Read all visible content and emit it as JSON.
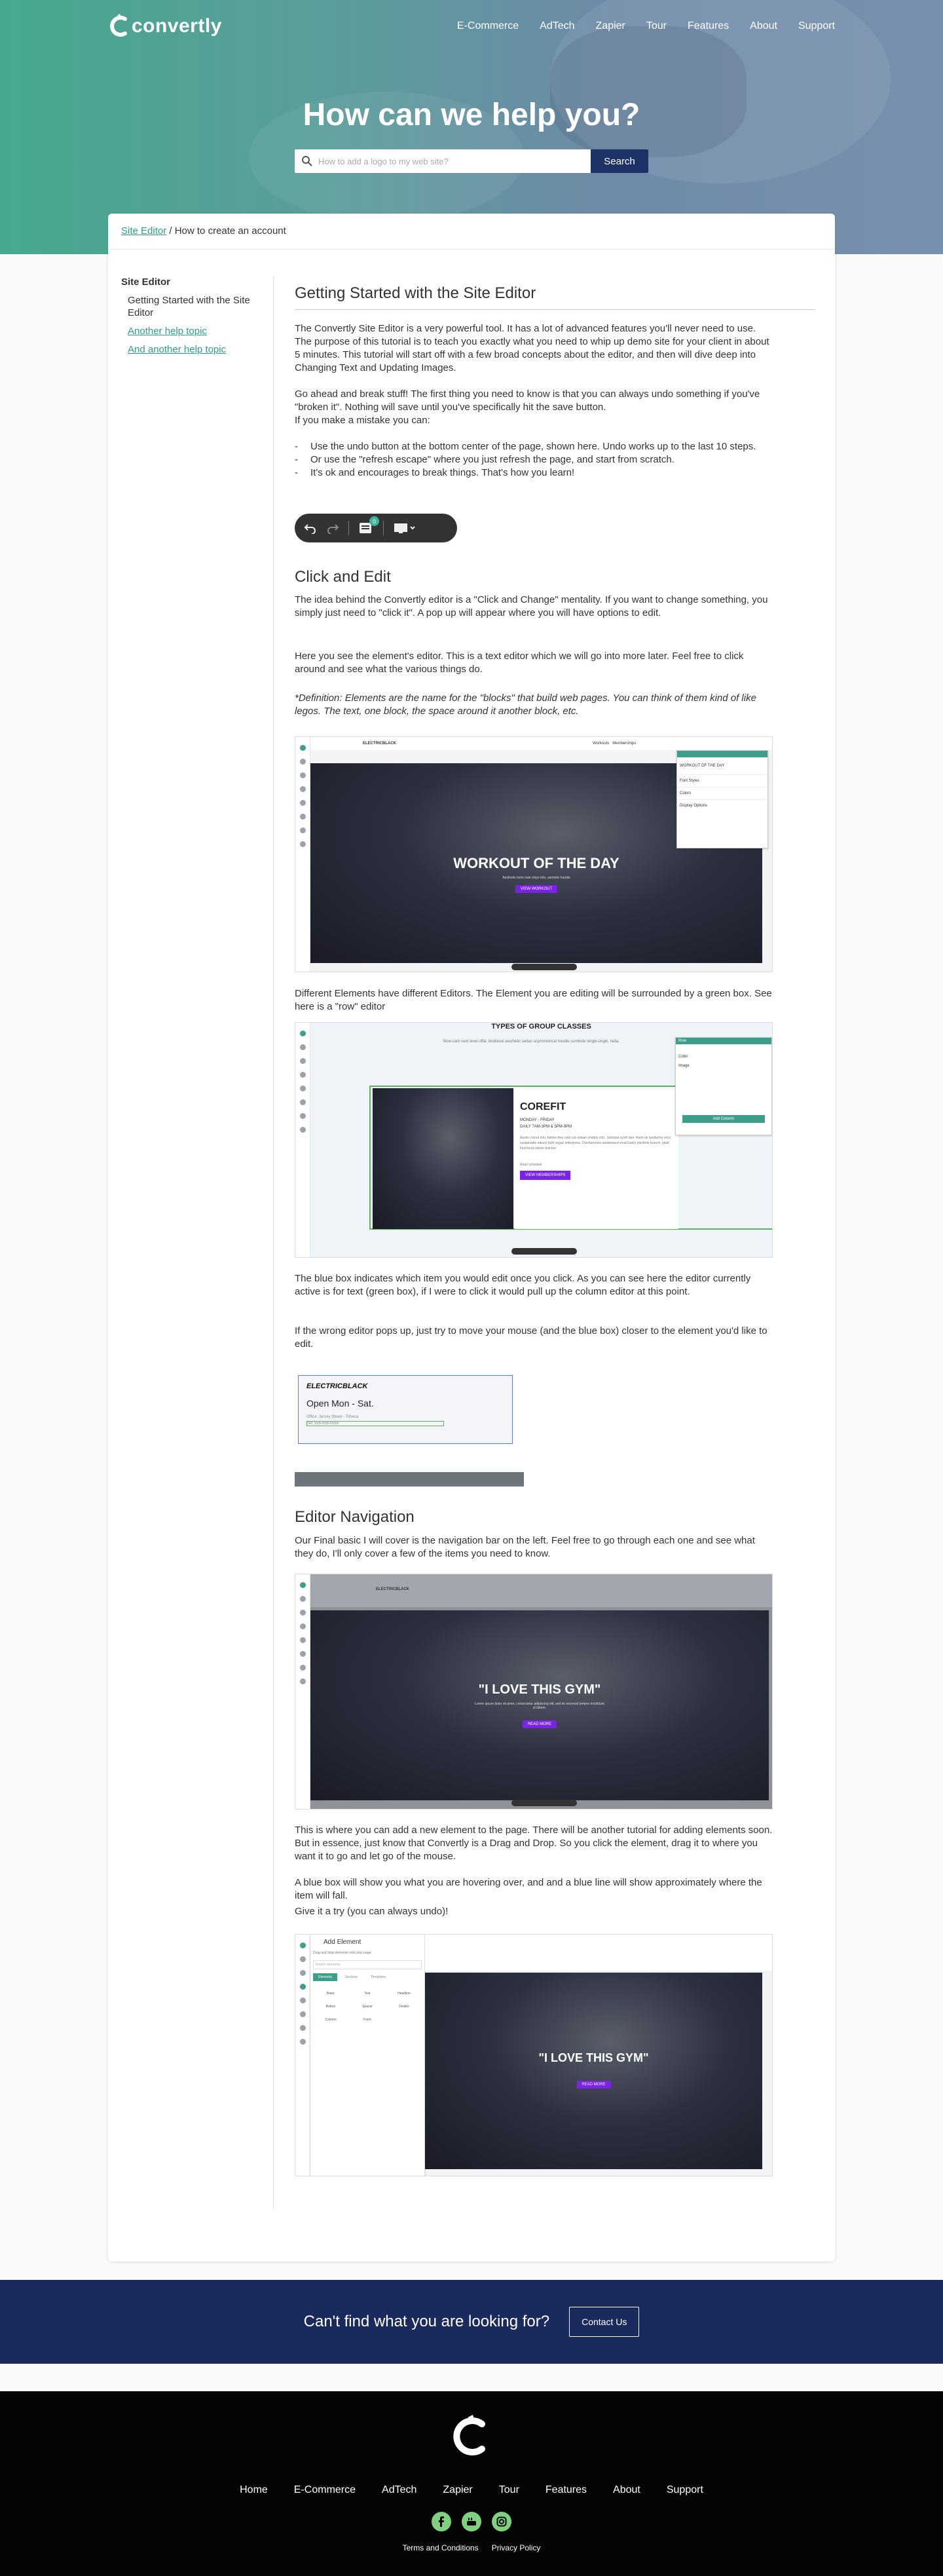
{
  "brand": {
    "name": "Convertly"
  },
  "nav": {
    "items": [
      "E-Commerce",
      "AdTech",
      "Zapier",
      "Tour",
      "Features",
      "About",
      "Support"
    ]
  },
  "hero": {
    "title": "How can we help you?",
    "search_placeholder": "How to add a logo to my web site?",
    "search_button": "Search"
  },
  "breadcrumb": {
    "link": "Site Editor",
    "sep": " / ",
    "current": "How to create an account"
  },
  "sidebar": {
    "heading": "Site Editor",
    "items": [
      {
        "label": "Getting Started with the Site Editor",
        "link": false
      },
      {
        "label": "Another help topic",
        "link": true
      },
      {
        "label": "And another help topic",
        "link": true
      }
    ]
  },
  "article": {
    "h1": "Getting Started with the Site Editor",
    "p1": "The Convertly Site Editor is a very powerful tool. It has a lot of advanced features you'll never need to use.  The purpose of this tutorial is to teach you exactly what you need to whip up demo site for your client in about 5 minutes.  This tutorial will start off with a few broad concepts about the editor, and then will dive deep into Changing Text and Updating Images.",
    "p2": "Go ahead and break stuff! The first thing you need to know is that you can always undo something if you've \"broken it\".  Nothing will save until you've specifically hit the save button.",
    "p3": "If you make a mistake you can:",
    "list": [
      "Use the undo button at the bottom center of the page, shown here. Undo works up to the last 10  steps.",
      "Or use the \"refresh escape\" where you just  refresh the page, and start from scratch.",
      "It's ok and encourages to break things.  That's how you learn!"
    ],
    "toolbar_badge": "0",
    "h2": "Click and Edit",
    "p4": "The idea behind the Convertly editor is a \"Click and Change\" mentality. If you want to change something, you simply just need to \"click it\". A pop up will appear where you will have options to edit.",
    "p5": "Here you see the element's editor.  This is a text editor which we will go into more later.  Feel free to click around and see what the various things do.",
    "p6": "*Definition: Elements are the name for the \"blocks\" that build web pages. You can think of them kind of like legos. The text, one block, the space around it another block, etc.",
    "shot1": {
      "brand": "ELECTRICBLACK",
      "nav1": "Workouts",
      "nav2": "Memberships",
      "title": "WORKOUT OF THE DAY",
      "sub": "Aesthetic lomo kale chips tofu, semiotic hoodie",
      "button": "VIEW WORKOUT",
      "panel_title": "WORKOUT OF THE DAY",
      "panel_row1": "Font Styles",
      "panel_row2": "Colors",
      "panel_row3": "Display Options"
    },
    "p7": "Different Elements have different Editors.  The Element you are editing will be surrounded by a green box.  See here is a \"row\" editor",
    "shot2": {
      "heading": "TYPES OF GROUP CLASSES",
      "intro": "Slow-carb next level offal, biodiesel aesthetic seitan asymmetrical hoodie cornhole single-origin, hella.",
      "class_name": "COREFIT",
      "days": "MONDAY - FRIDAY",
      "time": "DAILY 7AM-3PM & 5PM-9PM",
      "body": "Austin cronut tofu, before they sold out artisan shabby chic. Sartorial synth fam. Banh mi taxidermy vinyl, sustainable edison bulb vegan letterpress. Chicharrones skateboard small batch pitchfork brunch, plaid food truck listicle butcher.",
      "link": "Read schedule",
      "button": "VIEW MEMBERSHIPS",
      "panel_title": "Row",
      "panel_row1": "Color",
      "panel_row2": "Image",
      "panel_button": "Add Column"
    },
    "p8": "The blue box indicates which item you would edit once you click.  As you can see here the editor currently active is for text (green box), if I were to click it would pull up the column editor at this point.",
    "p9": "If the wrong editor pops up, just try to move your mouse (and the blue box) closer to the element you'd like to edit.",
    "shot3": {
      "brand": "ELECTRICBLACK",
      "hours": "Open Mon - Sat.",
      "address": "Office: Jersey Street - Tribeca",
      "phone": "Tel: 555-555-5555"
    },
    "h3": "Editor Navigation",
    "p10": "Our Final basic I will cover is the navigation bar on the left. Feel free to go through each one and see what they do, I'll only cover a few of the items you need to know.",
    "shot4": {
      "brand": "ELECTRICBLACK",
      "title": "\"I LOVE THIS GYM\"",
      "sub": "Lorem ipsum dolor sit amet, consectetur adipiscing elit, sed do eiusmod tempor incididunt ut labore.",
      "button": "READ MORE"
    },
    "p11": "This is where you can add a new element to the page. There will be another tutorial for adding elements soon. But in essence, just know that Convertly is a Drag and Drop. So you click the element, drag it to where you want it to go and let go of the mouse.",
    "p12": "A blue box will show you what you are hovering over, and and a blue line will show approximately where the item will fall.",
    "p13": "Give it a try (you can always undo)!",
    "shot5": {
      "panel_title": "Add Element",
      "panel_sub": "Drag and drop elements onto your page",
      "panel_search": "Search elements",
      "tab1": "Elements",
      "tab2": "Sections",
      "tab3": "Templates",
      "cat1": "Basic",
      "cat2": "Text",
      "cat3": "Headline",
      "cat4": "Button",
      "cat5": "Spacer",
      "cat6": "Divider",
      "cat7": "Column",
      "cat8": "Form",
      "title": "\"I LOVE THIS GYM\"",
      "button": "READ MORE"
    }
  },
  "cta": {
    "text": "Can't find what you are looking for?",
    "button": "Contact Us"
  },
  "footer": {
    "links": [
      "Home",
      "E-Commerce",
      "AdTech",
      "Zapier",
      "Tour",
      "Features",
      "About",
      "Support"
    ],
    "legal1": "Terms and Conditions",
    "legal2": "Privacy Policy"
  }
}
